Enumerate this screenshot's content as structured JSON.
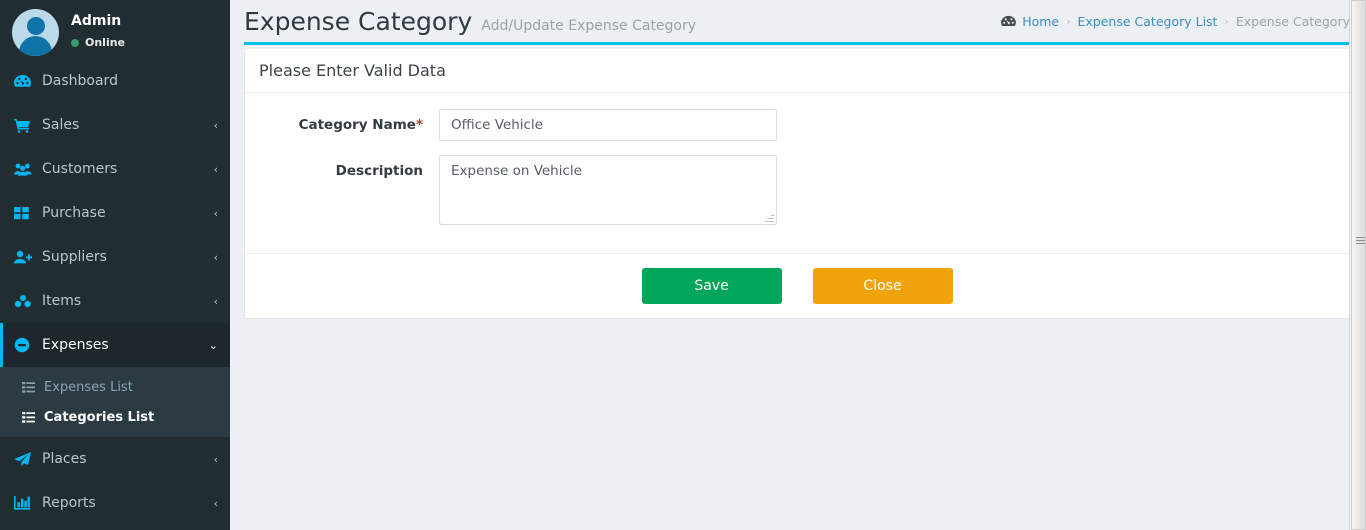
{
  "colors": {
    "sidebar_bg": "#222d32",
    "sidebar_active": "#1e282c",
    "submenu_bg": "#2c3b41",
    "accent": "#00c0ef",
    "icon_blue": "#00b7f1",
    "content_bg": "#ecf0f5",
    "save_green": "#00a65a",
    "close_orange": "#f0a30a",
    "required_red": "#b5342b",
    "online_green": "#3d9970"
  },
  "sidebar": {
    "user": {
      "name": "Admin",
      "status": "Online",
      "avatar_icon": "user-avatar-icon",
      "status_icon": "circle-dot-icon"
    },
    "items": [
      {
        "label": "Dashboard",
        "icon": "dashboard-tachometer-icon",
        "arrow": "",
        "active": false
      },
      {
        "label": "Sales",
        "icon": "shopping-cart-icon",
        "arrow": "‹",
        "active": false
      },
      {
        "label": "Customers",
        "icon": "users-group-icon",
        "arrow": "‹",
        "active": false
      },
      {
        "label": "Purchase",
        "icon": "grid-squares-icon",
        "arrow": "‹",
        "active": false
      },
      {
        "label": "Suppliers",
        "icon": "user-plus-icon",
        "arrow": "‹",
        "active": false
      },
      {
        "label": "Items",
        "icon": "cubes-icon",
        "arrow": "‹",
        "active": false
      },
      {
        "label": "Expenses",
        "icon": "minus-circle-icon",
        "arrow": "⌄",
        "active": true
      },
      {
        "label": "Places",
        "icon": "paper-plane-icon",
        "arrow": "‹",
        "active": false
      },
      {
        "label": "Reports",
        "icon": "bar-chart-icon",
        "arrow": "‹",
        "active": false
      }
    ],
    "expenses_submenu": [
      {
        "label": "Expenses List",
        "icon": "list-icon",
        "active": false
      },
      {
        "label": "Categories List",
        "icon": "list-icon",
        "active": true
      }
    ]
  },
  "header": {
    "title": "Expense Category",
    "subtitle": "Add/Update Expense Category",
    "breadcrumb": {
      "home_icon": "dashboard-home-icon",
      "home": "Home",
      "sep": "›",
      "parent": "Expense Category List",
      "current": "Expense Category"
    }
  },
  "panel": {
    "heading": "Please Enter Valid Data",
    "fields": {
      "category_name": {
        "label": "Category Name",
        "required_mark": "*",
        "value": "Office Vehicle",
        "placeholder": "Category Name"
      },
      "description": {
        "label": "Description",
        "value": "Expense on Vehicle",
        "placeholder": "Description"
      }
    },
    "buttons": {
      "save": "Save",
      "close": "Close"
    }
  }
}
